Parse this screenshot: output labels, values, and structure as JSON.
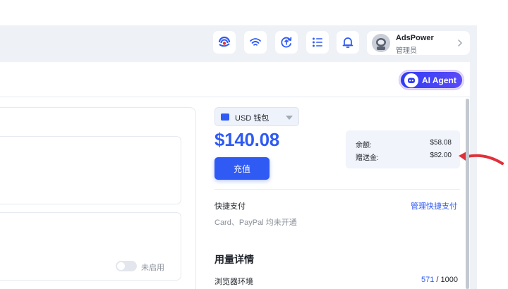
{
  "header": {
    "icons": [
      "adspower-logo-icon",
      "wifi-icon",
      "sync-icon",
      "list-icon",
      "bell-icon"
    ],
    "user": {
      "name": "AdsPower",
      "role": "管理员"
    }
  },
  "ai_agent": {
    "label": "AI Agent"
  },
  "left": {
    "toggle_label": "未启用"
  },
  "wallet": {
    "selector_label": "USD 钱包",
    "total": "$140.08",
    "topup_label": "充值",
    "details": [
      {
        "label": "余额:",
        "value": "$58.08"
      },
      {
        "label": "赠送金:",
        "value": "$82.00"
      }
    ]
  },
  "quick_pay": {
    "title": "快捷支付",
    "manage_link": "管理快捷支付",
    "desc": "Card、PayPal 均未开通"
  },
  "usage": {
    "title": "用量详情",
    "rows": [
      {
        "label": "浏览器环境",
        "used": "571",
        "sep": " / ",
        "total": "1000"
      }
    ]
  },
  "colors": {
    "accent": "#2f5af4",
    "annotation_arrow": "#e0303a"
  }
}
